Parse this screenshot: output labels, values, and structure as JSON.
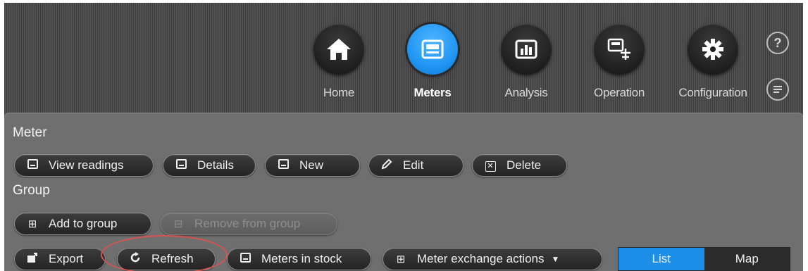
{
  "nav": {
    "items": [
      {
        "label": "Home",
        "icon": "home-icon"
      },
      {
        "label": "Meters",
        "icon": "meter-icon",
        "active": true
      },
      {
        "label": "Analysis",
        "icon": "bar-chart-icon"
      },
      {
        "label": "Operation",
        "icon": "operation-icon"
      },
      {
        "label": "Configuration",
        "icon": "gear-icon"
      }
    ],
    "help_label": "?"
  },
  "sections": {
    "meter_label": "Meter",
    "group_label": "Group"
  },
  "meter_buttons": {
    "view_readings": "View readings",
    "details": "Details",
    "new": "New",
    "edit": "Edit",
    "delete": "Delete"
  },
  "group_buttons": {
    "add_to_group": "Add to group",
    "remove_from_group": "Remove from group"
  },
  "actions": {
    "export": "Export",
    "refresh": "Refresh",
    "meters_in_stock": "Meters in stock",
    "meter_exchange_actions": "Meter exchange actions"
  },
  "view_toggle": {
    "list": "List",
    "map": "Map",
    "selected": "List"
  },
  "colors": {
    "accent": "#2196f3",
    "panel": "#6f6f6f",
    "highlight": "#d9534f"
  }
}
